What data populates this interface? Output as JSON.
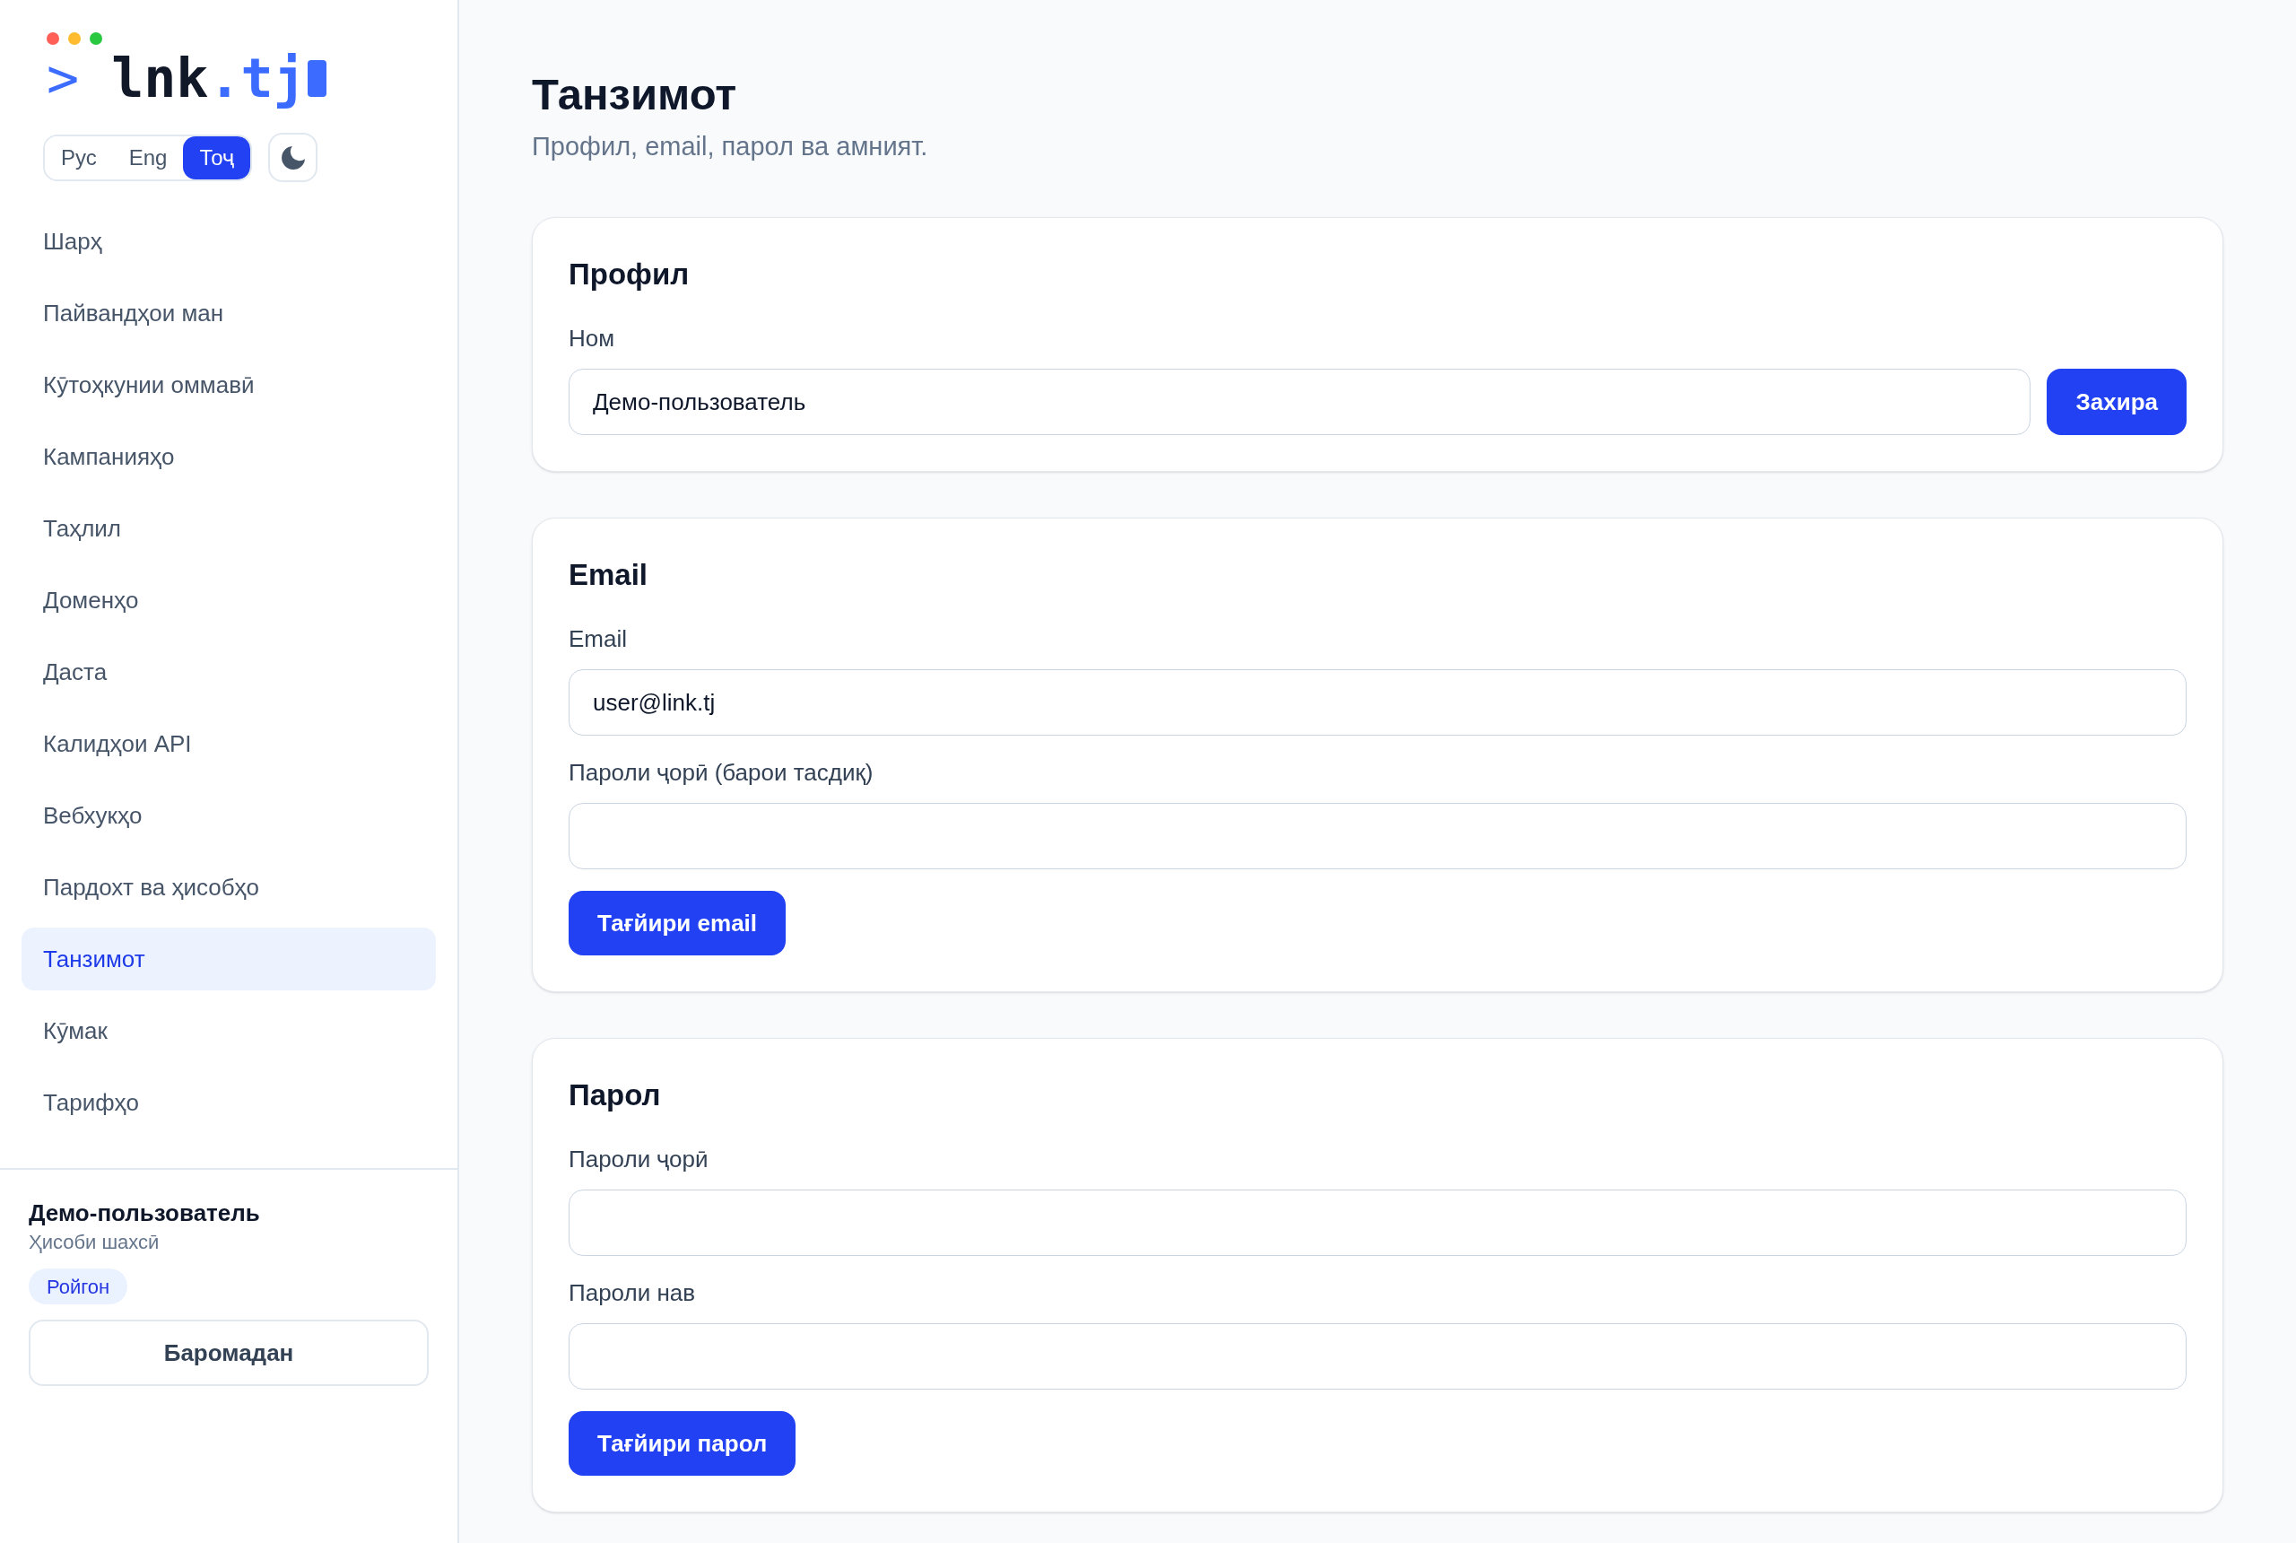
{
  "sidebar": {
    "logo": {
      "prompt": ">",
      "name": "lnk",
      "domain": ".tj"
    },
    "languages": [
      {
        "label": "Рус",
        "selected": false
      },
      {
        "label": "Eng",
        "selected": false
      },
      {
        "label": "Тоҷ",
        "selected": true
      }
    ],
    "nav_items": [
      {
        "label": "Шарҳ",
        "selected": false
      },
      {
        "label": "Пайвандҳои ман",
        "selected": false
      },
      {
        "label": "Кӯтоҳкунии оммавӣ",
        "selected": false
      },
      {
        "label": "Кампанияҳо",
        "selected": false
      },
      {
        "label": "Таҳлил",
        "selected": false
      },
      {
        "label": "Доменҳо",
        "selected": false
      },
      {
        "label": "Даста",
        "selected": false
      },
      {
        "label": "Калидҳои API",
        "selected": false
      },
      {
        "label": "Вебхукҳо",
        "selected": false
      },
      {
        "label": "Пардохт ва ҳисобҳо",
        "selected": false
      },
      {
        "label": "Танзимот",
        "selected": true
      },
      {
        "label": "Кӯмак",
        "selected": false
      },
      {
        "label": "Тарифҳо",
        "selected": false
      }
    ],
    "user": {
      "name": "Демо-пользователь",
      "account_type": "Ҳисоби шахсӣ",
      "plan_badge": "Ройгон"
    },
    "logout_button": "Баромадан"
  },
  "page": {
    "title": "Танзимот",
    "subtitle": "Профил, email, парол ва амният."
  },
  "sections": [
    {
      "kind": "inline",
      "title": "Профил",
      "fields": [
        {
          "label": "Ном",
          "value": "Демо-пользователь"
        }
      ],
      "button": "Захира"
    },
    {
      "kind": "stacked",
      "title": "Email",
      "fields": [
        {
          "label": "Email",
          "value": "user@link.tj"
        },
        {
          "label": "Пароли ҷорӣ (барои тасдиқ)"
        }
      ],
      "button": "Тағйири email"
    },
    {
      "kind": "stacked",
      "title": "Парол",
      "fields": [
        {
          "label": "Пароли ҷорӣ"
        },
        {
          "label": "Пароли нав"
        }
      ],
      "button": "Тағйири парол"
    }
  ]
}
